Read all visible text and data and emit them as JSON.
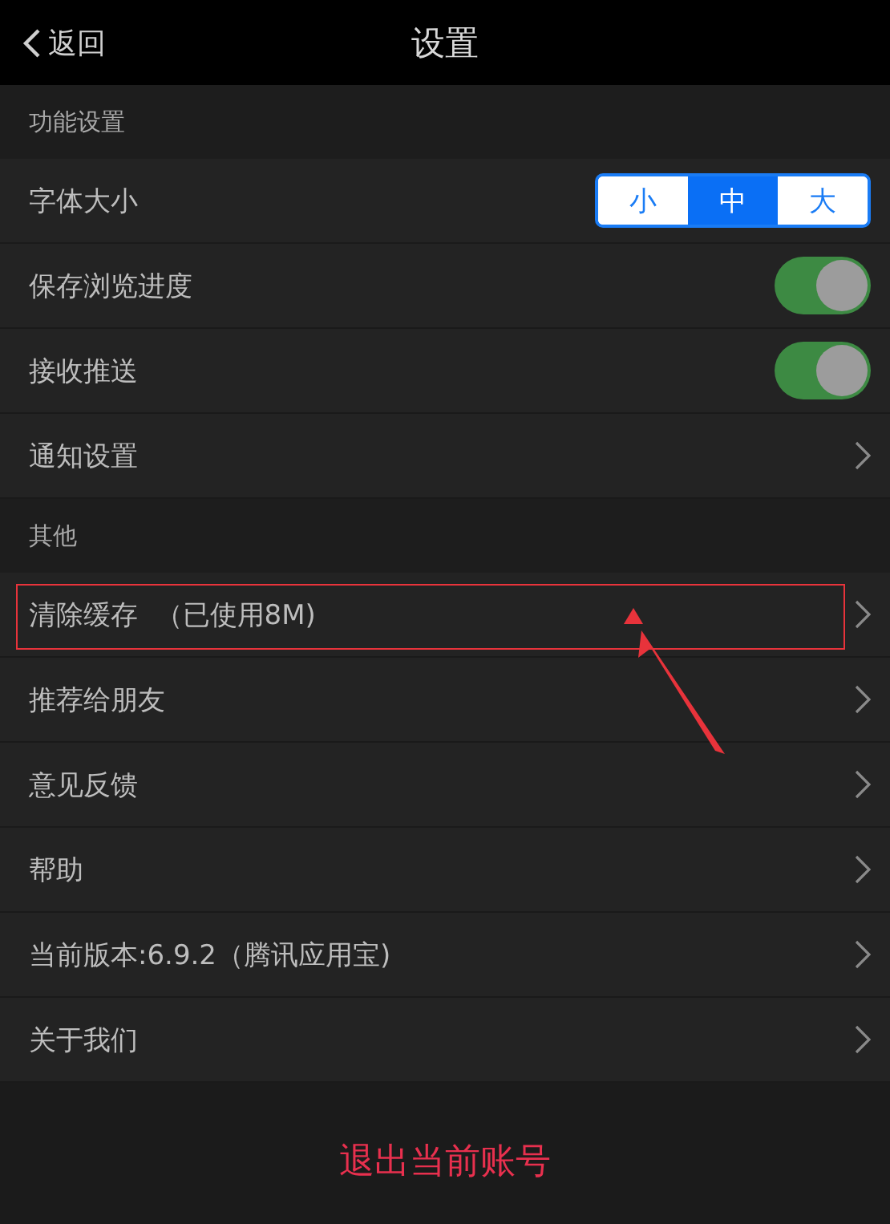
{
  "nav_bar": {
    "back": "返回",
    "title": "设置"
  },
  "sections": [
    {
      "header": "功能设置",
      "items": [
        {
          "kind": "segmented",
          "label": "字体大小",
          "options": [
            {
              "label": "小",
              "selected": false
            },
            {
              "label": "中",
              "selected": true
            },
            {
              "label": "大",
              "selected": false
            }
          ]
        },
        {
          "kind": "toggle",
          "label": "保存浏览进度",
          "on": true
        },
        {
          "kind": "toggle",
          "label": "接收推送",
          "on": true
        },
        {
          "kind": "link",
          "label": "通知设置"
        }
      ]
    },
    {
      "header": "其他",
      "items": [
        {
          "kind": "link",
          "label": "清除缓存  （已使用8M)",
          "annotated": true
        },
        {
          "kind": "link",
          "label": "推荐给朋友"
        },
        {
          "kind": "link",
          "label": "意见反馈"
        },
        {
          "kind": "link",
          "label": "帮助"
        },
        {
          "kind": "link",
          "label": "当前版本:6.9.2（腾讯应用宝)"
        },
        {
          "kind": "link",
          "label": "关于我们"
        }
      ]
    }
  ],
  "logout_button": "退出当前账号"
}
